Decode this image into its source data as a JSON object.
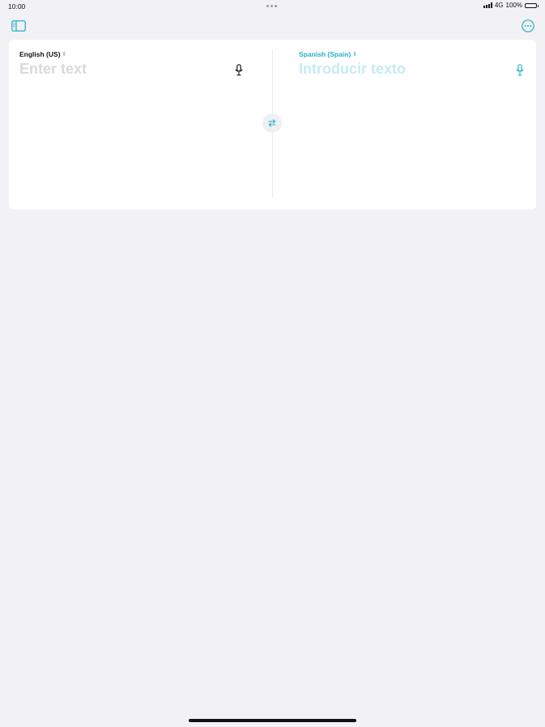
{
  "status_bar": {
    "time": "10:00",
    "network": "4G",
    "battery": "100%",
    "signal_icon": "signal-bars-icon",
    "battery_icon": "battery-full-icon"
  },
  "toolbar": {
    "sidebar_icon": "sidebar-toggle-icon",
    "more_icon": "ellipsis-circle-icon"
  },
  "source": {
    "language": "English (US)",
    "placeholder": "Enter text",
    "value": "",
    "mic_icon": "microphone-icon"
  },
  "target": {
    "language": "Spanish (Spain)",
    "placeholder": "Introducir texto",
    "value": "",
    "mic_icon": "microphone-icon"
  },
  "swap": {
    "icon": "swap-arrows-icon"
  },
  "colors": {
    "accent": "#2ab0c6",
    "background": "#f1f1f6",
    "card": "#ffffff"
  }
}
